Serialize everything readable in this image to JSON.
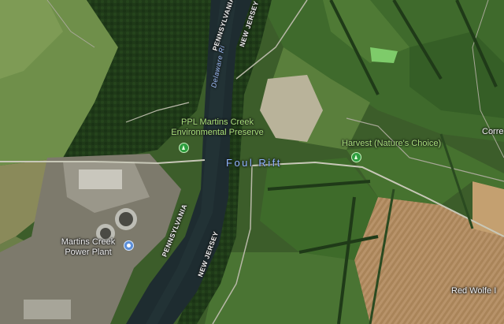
{
  "map": {
    "view": "satellite",
    "places": {
      "ppl_line1": "PPL Martins Creek",
      "ppl_line2": "Environmental Preserve",
      "harvest": "Harvest (Nature's Choice)",
      "power_line1": "Martins Creek",
      "power_line2": "Power Plant",
      "foul_rift": "Foul Rift",
      "red_wolfe": "Red Wolfe I",
      "corre": "Corre"
    },
    "state_labels": {
      "pa_top": "PENNSYLVANIA",
      "nj_top": "NEW JERSEY",
      "pa_bottom": "PENNSYLVANIA",
      "nj_bottom": "NEW JERSEY"
    },
    "water": {
      "river": "Delaware Ri"
    },
    "icons": {
      "park_pin": "park-pin-icon",
      "utility_pin": "utility-pin-icon"
    },
    "colors": {
      "place_label": "#a8e07a",
      "rift_label": "#8fb8ff",
      "river": "#1e2c30"
    }
  }
}
